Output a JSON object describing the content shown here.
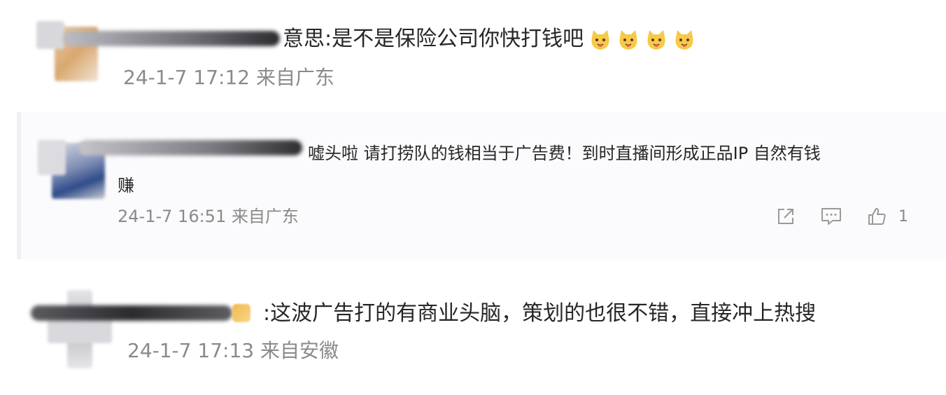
{
  "comments": [
    {
      "text": "意思:是不是保险公司你快打钱吧",
      "emoji_icons": [
        "cat-face-icon",
        "cat-face-icon",
        "cat-face-icon",
        "cat-face-icon"
      ],
      "date": "24-1-7",
      "time": "17:12",
      "location": "来自广东"
    },
    {
      "text_line1": "嘘头啦  请打捞队的钱相当于广告费！到时直播间形成正品IP   自然有钱",
      "text_line2": "赚",
      "date": "24-1-7",
      "time": "16:51",
      "location": "来自广东",
      "actions": {
        "share_icon": "share-icon",
        "comment_icon": "comment-icon",
        "like_icon": "thumbs-up-icon",
        "like_count": "1"
      }
    },
    {
      "text": ":这波广告打的有商业头脑，策划的也很不错，直接冲上热搜",
      "date": "24-1-7",
      "time": "17:13",
      "location": "来自安徽"
    }
  ],
  "colors": {
    "text": "#262626",
    "meta": "#8a8a8a",
    "reply_bg": "#fbfbfd",
    "emoji_yellow": "#f7c948"
  }
}
